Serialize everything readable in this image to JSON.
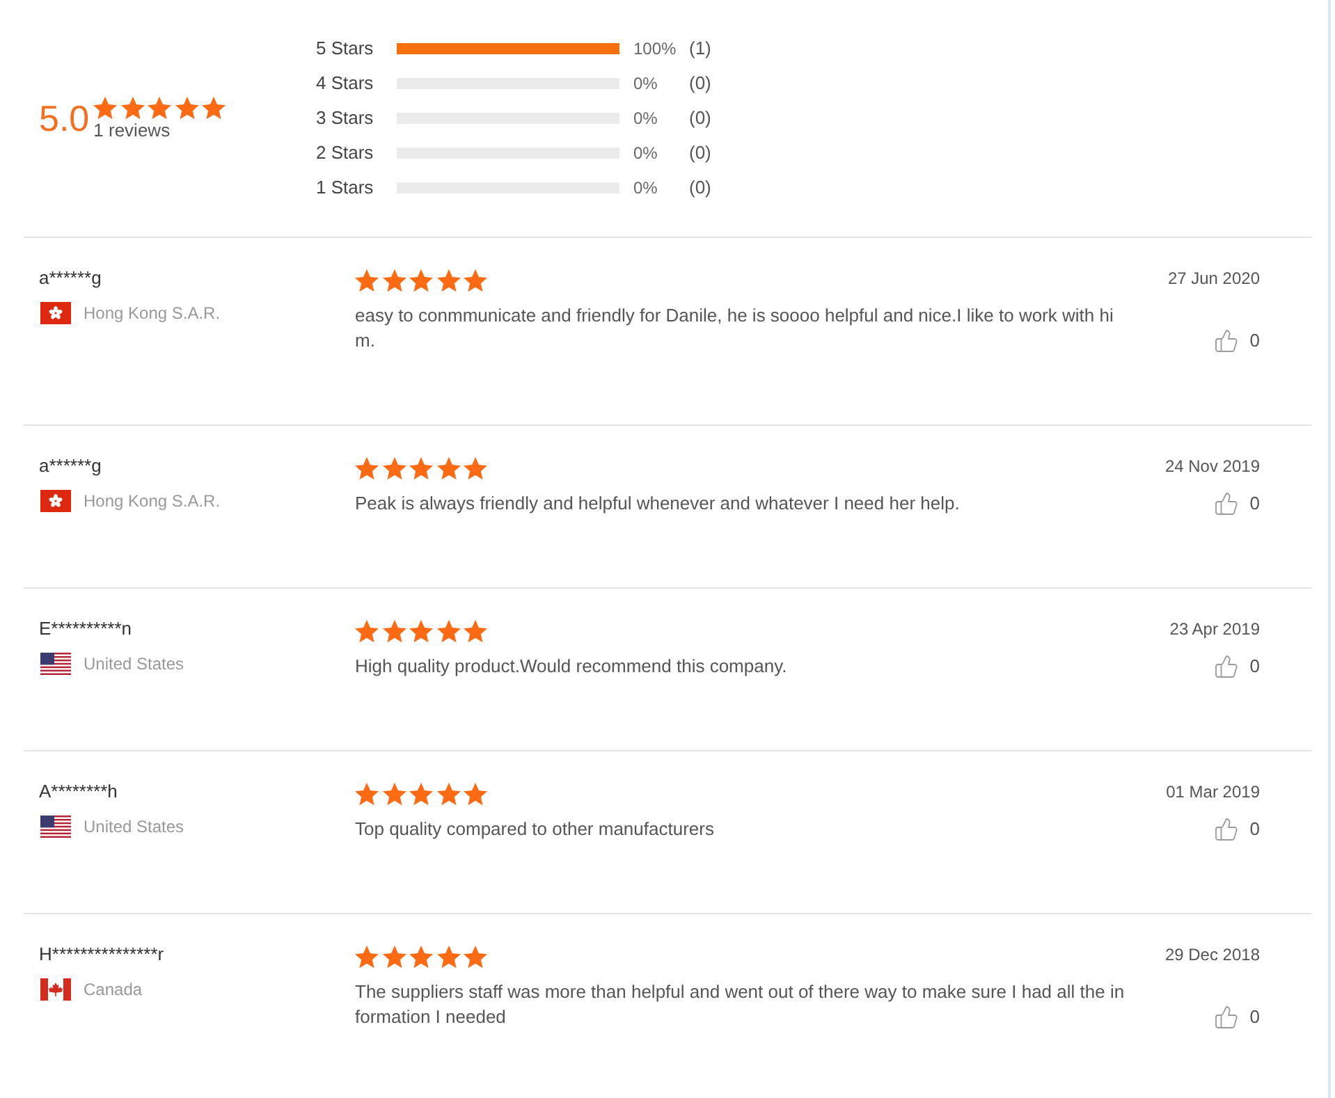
{
  "summary": {
    "score": "5.0",
    "stars": 5,
    "count_label": "1 reviews"
  },
  "breakdown": [
    {
      "label": "5 Stars",
      "level": 1,
      "percent": "100%",
      "count": "(1)"
    },
    {
      "label": "4 Stars",
      "level": 0,
      "percent": "0%",
      "count": "(0)"
    },
    {
      "label": "3 Stars",
      "level": 0,
      "percent": "0%",
      "count": "(0)"
    },
    {
      "label": "2 Stars",
      "level": 0,
      "percent": "0%",
      "count": "(0)"
    },
    {
      "label": "1 Stars",
      "level": 0,
      "percent": "0%",
      "count": "(0)"
    }
  ],
  "reviews": [
    {
      "name": "a******g",
      "kind": "hk",
      "country": "Hong Kong S.A.R.",
      "stars": 5,
      "text": "easy to conmmunicate and friendly for Danile, he is soooo helpful and nice.I like to work with him.",
      "date": "27 Jun 2020",
      "likes": "0"
    },
    {
      "name": "a******g",
      "kind": "hk",
      "country": "Hong Kong S.A.R.",
      "stars": 5,
      "text": "Peak is always friendly and helpful whenever and whatever I need her help.",
      "date": "24 Nov 2019",
      "likes": "0"
    },
    {
      "name": "E**********n",
      "kind": "us",
      "country": "United States",
      "stars": 5,
      "text": "High quality product.Would recommend this company.",
      "date": "23 Apr 2019",
      "likes": "0"
    },
    {
      "name": "A********h",
      "kind": "us",
      "country": "United States",
      "stars": 5,
      "text": "Top quality compared to other manufacturers",
      "date": "01 Mar 2019",
      "likes": "0"
    },
    {
      "name": "H***************r",
      "kind": "ca",
      "country": "Canada",
      "stars": 5,
      "text": "The suppliers staff was more than helpful and went out of there way to make sure I had all the information I needed",
      "date": "29 Dec 2018",
      "likes": "0"
    }
  ]
}
